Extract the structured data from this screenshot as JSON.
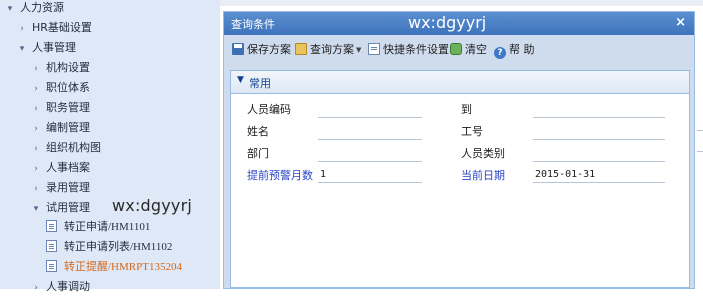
{
  "nav": {
    "items": [
      {
        "label": "人力资源"
      },
      {
        "label": "HR基础设置"
      },
      {
        "label": "人事管理"
      },
      {
        "label": "机构设置"
      },
      {
        "label": "职位体系"
      },
      {
        "label": "职务管理"
      },
      {
        "label": "编制管理"
      },
      {
        "label": "组织机构图"
      },
      {
        "label": "人事档案"
      },
      {
        "label": "录用管理"
      },
      {
        "label": "试用管理"
      },
      {
        "label": "转正申请/HM1101"
      },
      {
        "label": "转正申请列表/HM1102"
      },
      {
        "label": "转正提醒/HMRPT135204"
      },
      {
        "label": "人事调动"
      }
    ],
    "watermark": "wx:dgyyrj"
  },
  "dialog": {
    "title": "查询条件",
    "watermark": "wx:dgyyrj",
    "close": "×",
    "toolbar": {
      "save": "保存方案",
      "scheme": "查询方案",
      "quick": "快捷条件设置",
      "clear": "清空",
      "help": "帮 助"
    },
    "section_title": "常用",
    "fields": {
      "emp_code": {
        "label": "人员编码",
        "value": ""
      },
      "to": {
        "label": "到",
        "value": ""
      },
      "name": {
        "label": "姓名",
        "value": ""
      },
      "job_no": {
        "label": "工号",
        "value": ""
      },
      "dept": {
        "label": "部门",
        "value": ""
      },
      "emp_type": {
        "label": "人员类别",
        "value": ""
      },
      "advance_months": {
        "label": "提前预警月数",
        "value": "1"
      },
      "current_date": {
        "label": "当前日期",
        "value": "2015-01-31"
      }
    }
  },
  "colors": {
    "title_bar": "#3e73bd",
    "link_blue": "#2a45c8",
    "active_orange": "#d2691e"
  }
}
